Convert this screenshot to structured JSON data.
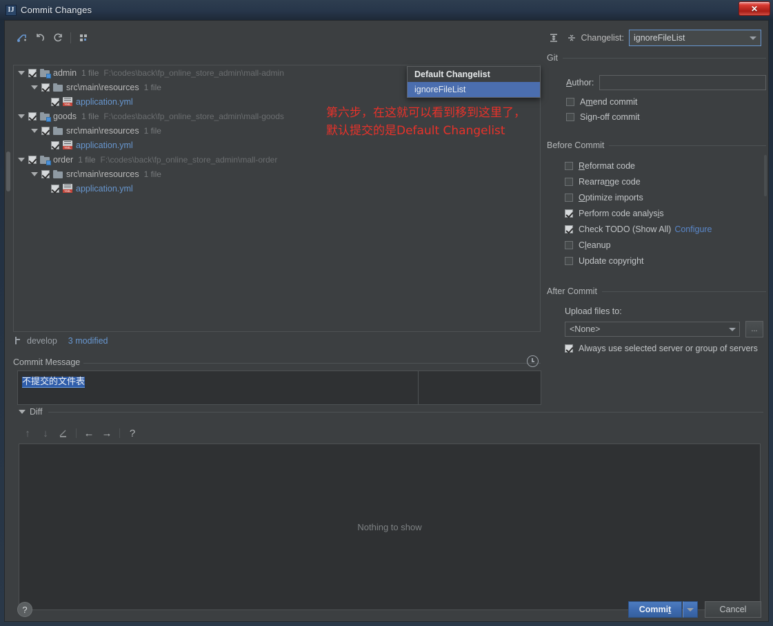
{
  "window": {
    "title": "Commit Changes",
    "app_icon": "intellij-idea-icon",
    "close_label": "✕"
  },
  "toolbar": {
    "icons": [
      {
        "name": "show-diff-icon",
        "glyph": "✨"
      },
      {
        "name": "revert-icon",
        "glyph": "↶"
      },
      {
        "name": "refresh-icon",
        "glyph": "⟳"
      },
      {
        "name": "group-by-icon",
        "glyph": "∷"
      }
    ],
    "expand_all_icon": "expand-all-icon",
    "collapse_all_icon": "collapse-all-icon",
    "changelist_label": "Changelist:",
    "changelist_value": "ignoreFileList"
  },
  "changelist_popup": {
    "options": [
      {
        "label": "Default Changelist",
        "bold": true,
        "selected": false
      },
      {
        "label": "ignoreFileList",
        "bold": false,
        "selected": true
      }
    ]
  },
  "tree": [
    {
      "indent": 0,
      "kind": "module",
      "checked": true,
      "expanded": true,
      "name": "admin",
      "meta": "1 file",
      "path": "F:\\codes\\back\\fp_online_store_admin\\mall-admin"
    },
    {
      "indent": 1,
      "kind": "folder",
      "checked": true,
      "expanded": true,
      "name": "src\\main\\resources",
      "meta": "1 file",
      "path": ""
    },
    {
      "indent": 2,
      "kind": "yml",
      "checked": true,
      "expanded": null,
      "name": "application.yml",
      "meta": "",
      "path": ""
    },
    {
      "indent": 0,
      "kind": "module",
      "checked": true,
      "expanded": true,
      "name": "goods",
      "meta": "1 file",
      "path": "F:\\codes\\back\\fp_online_store_admin\\mall-goods"
    },
    {
      "indent": 1,
      "kind": "folder",
      "checked": true,
      "expanded": true,
      "name": "src\\main\\resources",
      "meta": "1 file",
      "path": ""
    },
    {
      "indent": 2,
      "kind": "yml",
      "checked": true,
      "expanded": null,
      "name": "application.yml",
      "meta": "",
      "path": ""
    },
    {
      "indent": 0,
      "kind": "module",
      "checked": true,
      "expanded": true,
      "name": "order",
      "meta": "1 file",
      "path": "F:\\codes\\back\\fp_online_store_admin\\mall-order"
    },
    {
      "indent": 1,
      "kind": "folder",
      "checked": true,
      "expanded": true,
      "name": "src\\main\\resources",
      "meta": "1 file",
      "path": ""
    },
    {
      "indent": 2,
      "kind": "yml",
      "checked": true,
      "expanded": null,
      "name": "application.yml",
      "meta": "",
      "path": ""
    }
  ],
  "annotation": {
    "color": "#e8322a",
    "line1": "第六步，在这就可以看到移到这里了，",
    "line2": "默认提交的是Default Changelist"
  },
  "status": {
    "branch_icon": "git-branch-icon",
    "branch": "develop",
    "modified": "3 modified"
  },
  "commit_message": {
    "label": "Commit Message",
    "history_icon": "clock-history-icon",
    "value": "不提交的文件表"
  },
  "diff": {
    "title": "Diff",
    "toolbar": [
      {
        "name": "previous-difference-icon",
        "glyph": "↑"
      },
      {
        "name": "next-difference-icon",
        "glyph": "↓"
      },
      {
        "name": "annotate-icon",
        "glyph": "╱"
      },
      {
        "name": "accept-left-icon",
        "glyph": "←"
      },
      {
        "name": "accept-right-icon",
        "glyph": "→"
      },
      {
        "name": "help-icon",
        "glyph": "?"
      }
    ],
    "empty_text": "Nothing to show"
  },
  "git": {
    "title": "Git",
    "author_label": "Author:",
    "author_value": "",
    "amend_label": "Amend commit",
    "amend_checked": false,
    "signoff_label": "Sign-off commit",
    "signoff_checked": false
  },
  "before_commit": {
    "title": "Before Commit",
    "items": [
      {
        "label": "Reformat code",
        "checked": false
      },
      {
        "label": "Rearrange code",
        "checked": false
      },
      {
        "label": "Optimize imports",
        "checked": false
      },
      {
        "label": "Perform code analysis",
        "checked": true
      },
      {
        "label": "Check TODO (Show All)",
        "checked": true,
        "link": "Configure"
      },
      {
        "label": "Cleanup",
        "checked": false
      },
      {
        "label": "Update copyright",
        "checked": false
      }
    ]
  },
  "after_commit": {
    "title": "After Commit",
    "upload_label": "Upload files to:",
    "upload_value": "<None>",
    "browse_label": "...",
    "always_label": "Always use selected server or group of servers",
    "always_checked": true
  },
  "footer": {
    "help_label": "?",
    "commit_label": "Commit",
    "commit_split_icon": "chevron-down-icon",
    "cancel_label": "Cancel"
  }
}
